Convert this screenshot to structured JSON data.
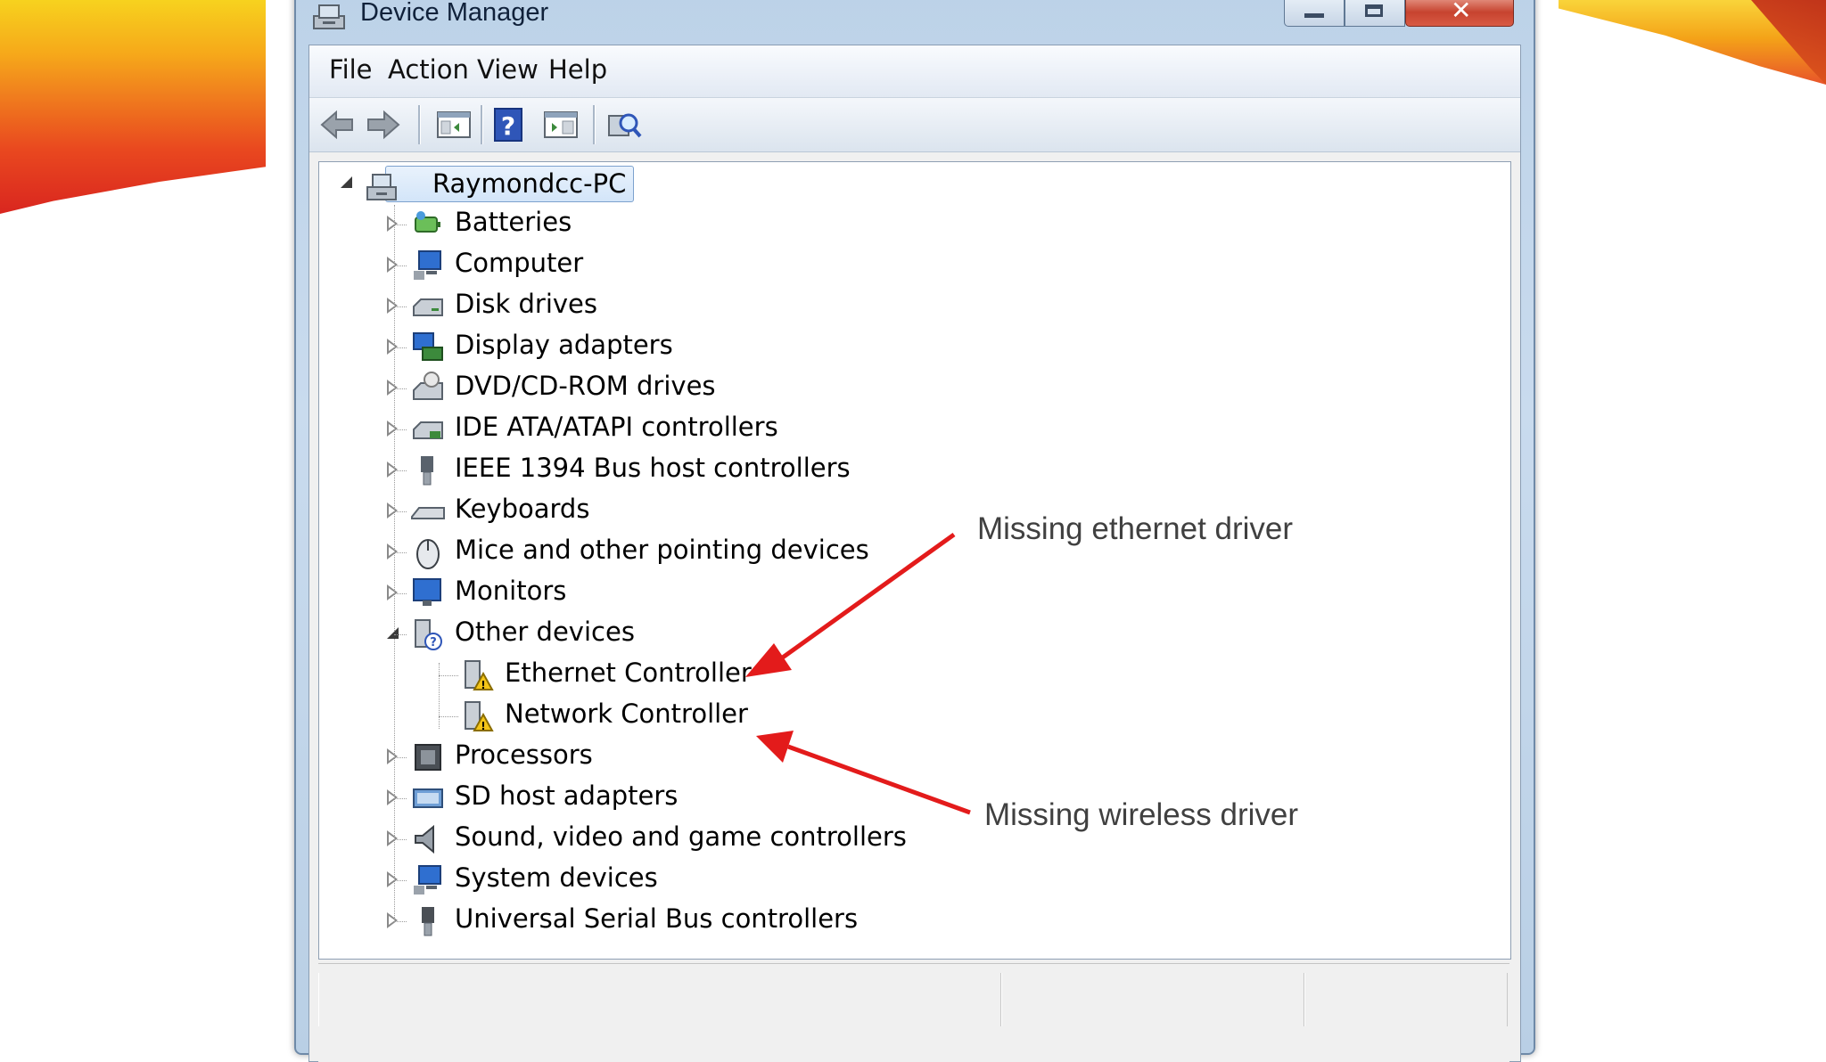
{
  "window": {
    "title": "Device Manager"
  },
  "menu": {
    "items": [
      "File",
      "Action",
      "View",
      "Help"
    ]
  },
  "toolbar": {
    "buttons": [
      "back-arrow-icon",
      "forward-arrow-icon",
      "show-hide-console-tree-icon",
      "help-icon",
      "properties-icon",
      "scan-hardware-icon"
    ]
  },
  "tree": {
    "root": "Raymondcc-PC",
    "categories": [
      {
        "label": "Batteries",
        "icon": "battery-icon",
        "expanded": false
      },
      {
        "label": "Computer",
        "icon": "computer-icon",
        "expanded": false
      },
      {
        "label": "Disk drives",
        "icon": "disk-drive-icon",
        "expanded": false
      },
      {
        "label": "Display adapters",
        "icon": "display-adapter-icon",
        "expanded": false
      },
      {
        "label": "DVD/CD-ROM drives",
        "icon": "dvd-drive-icon",
        "expanded": false
      },
      {
        "label": "IDE ATA/ATAPI controllers",
        "icon": "ide-controller-icon",
        "expanded": false
      },
      {
        "label": "IEEE 1394 Bus host controllers",
        "icon": "ieee1394-icon",
        "expanded": false
      },
      {
        "label": "Keyboards",
        "icon": "keyboard-icon",
        "expanded": false
      },
      {
        "label": "Mice and other pointing devices",
        "icon": "mouse-icon",
        "expanded": false
      },
      {
        "label": "Monitors",
        "icon": "monitor-icon",
        "expanded": false
      },
      {
        "label": "Other devices",
        "icon": "unknown-device-icon",
        "expanded": true,
        "children": [
          {
            "label": "Ethernet Controller",
            "icon": "warning-device-icon"
          },
          {
            "label": "Network Controller",
            "icon": "warning-device-icon"
          }
        ]
      },
      {
        "label": "Processors",
        "icon": "processor-icon",
        "expanded": false
      },
      {
        "label": "SD host adapters",
        "icon": "sd-adapter-icon",
        "expanded": false
      },
      {
        "label": "Sound, video and game controllers",
        "icon": "speaker-icon",
        "expanded": false
      },
      {
        "label": "System devices",
        "icon": "system-device-icon",
        "expanded": false
      },
      {
        "label": "Universal Serial Bus controllers",
        "icon": "usb-icon",
        "expanded": false
      }
    ]
  },
  "annotations": {
    "ethernet": "Missing ethernet driver",
    "wireless": "Missing wireless driver",
    "arrow_color": "#e31b1b"
  },
  "colors": {
    "selection_border": "#7da2ce",
    "window_frame": "#bcd2e8"
  }
}
